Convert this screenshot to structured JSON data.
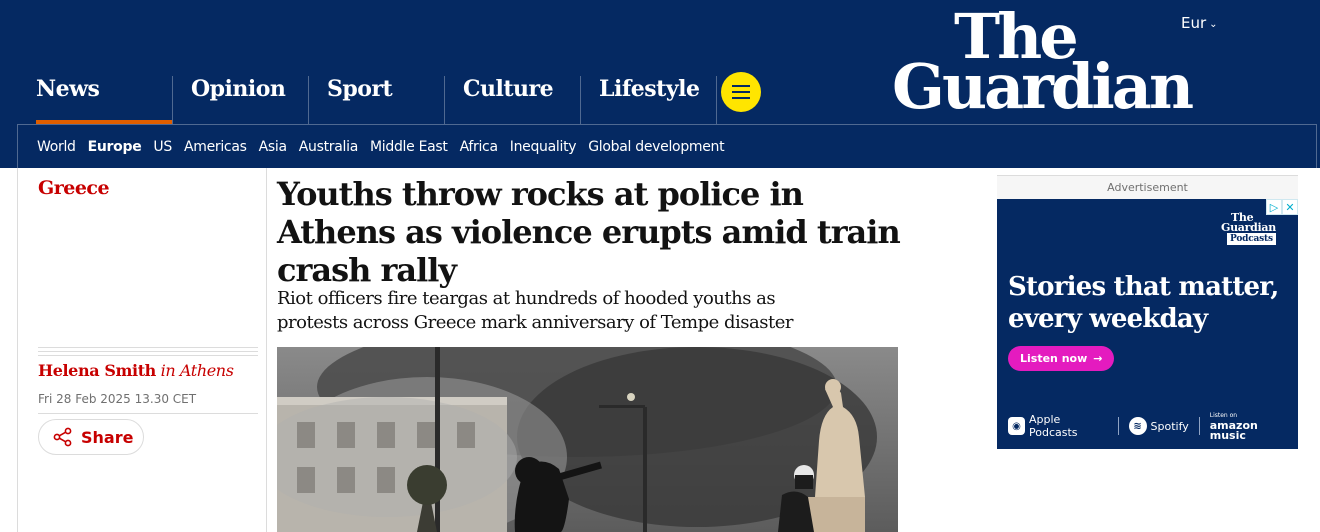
{
  "header": {
    "edition": "Eur",
    "logo": {
      "line1": "The",
      "line2": "Guardian"
    },
    "pillars": [
      {
        "label": "News",
        "active": true
      },
      {
        "label": "Opinion",
        "active": false
      },
      {
        "label": "Sport",
        "active": false
      },
      {
        "label": "Culture",
        "active": false
      },
      {
        "label": "Lifestyle",
        "active": false
      }
    ],
    "subnav": [
      "World",
      "Europe",
      "US",
      "Americas",
      "Asia",
      "Australia",
      "Middle East",
      "Africa",
      "Inequality",
      "Global development"
    ],
    "subnav_current": "Europe"
  },
  "article": {
    "series": "Greece",
    "headline": "Youths throw rocks at police in Athens as violence erupts amid train crash rally",
    "standfirst": "Riot officers fire teargas at hundreds of hooded youths as protests across Greece mark anniversary of Tempe disaster",
    "byline": {
      "name": "Helena Smith",
      "location": "in Athens"
    },
    "date": "Fri 28 Feb 2025 13.30 CET",
    "share_label": "Share"
  },
  "ad": {
    "label": "Advertisement",
    "logo_line1": "The",
    "logo_line2": "Guardian",
    "logo_badge": "Podcasts",
    "headline": "Stories that matter, every weekday",
    "cta": "Listen now",
    "platforms": {
      "apple": "Apple Podcasts",
      "spotify": "Spotify",
      "amazon_small": "Listen on",
      "amazon_large": "amazon music"
    }
  },
  "colors": {
    "brand_navy": "#052962",
    "news_red": "#c70000",
    "accent_yellow": "#ffe500",
    "pillar_underline": "#e05e00",
    "ad_cta_pink": "#e41bbf"
  }
}
